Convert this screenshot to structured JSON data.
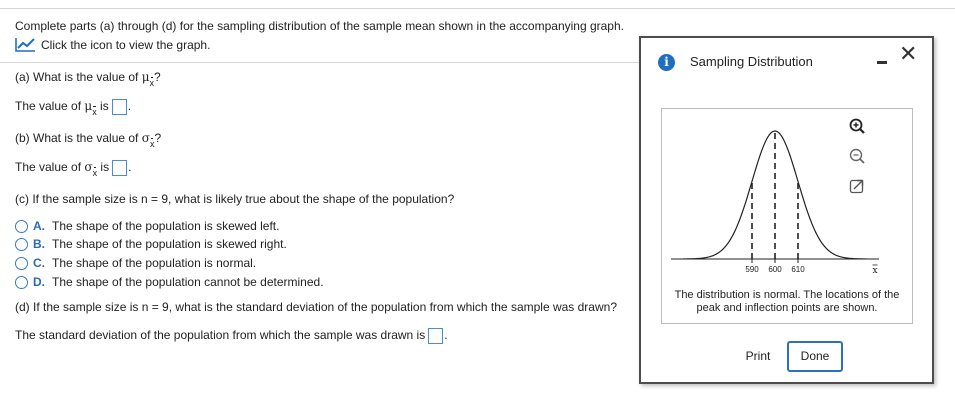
{
  "intro": "Complete parts (a) through (d) for the sampling distribution of the sample mean shown in the accompanying graph.",
  "graph_link": "Click the icon to view the graph.",
  "part_a": {
    "question_pre": "(a) What is the value of ",
    "question_sym": "μ",
    "question_post": "?",
    "answer_pre": "The value of ",
    "answer_sym": "μ",
    "answer_post": " is"
  },
  "part_b": {
    "question_pre": "(b) What is the value of ",
    "question_sym": "σ",
    "question_post": "?",
    "answer_pre": "The value of ",
    "answer_sym": "σ",
    "answer_post": " is"
  },
  "part_c": {
    "question": "(c) If the sample size is n = 9, what is likely true about the shape of the population?",
    "options": [
      {
        "letter": "A.",
        "text": "The shape of the population is skewed left."
      },
      {
        "letter": "B.",
        "text": "The shape of the population is skewed right."
      },
      {
        "letter": "C.",
        "text": "The shape of the population is normal."
      },
      {
        "letter": "D.",
        "text": "The shape of the population cannot be determined."
      }
    ]
  },
  "part_d": {
    "question": "(d) If the sample size is n = 9, what is the standard deviation of the population from which the sample was drawn?",
    "answer_pre": "The standard deviation of the population from which the sample was drawn is"
  },
  "subscript_symbol": "x",
  "dialog": {
    "info_glyph": "i",
    "title": "Sampling Distribution",
    "close_glyph": "✕",
    "graph": {
      "tick_labels": [
        "590",
        "600",
        "610"
      ],
      "axis_symbol": "x",
      "mean": 600,
      "sd": 10,
      "inflection_points": [
        590,
        610
      ]
    },
    "caption": "The distribution is normal. The locations of the peak and inflection points are shown.",
    "print_label": "Print",
    "done_label": "Done"
  },
  "colors": {
    "link_icon": "#1f6fc1",
    "option_letter": "#2a6ab3",
    "answer_box_border": "#4a8bd3",
    "done_border": "#2e6fbb"
  }
}
